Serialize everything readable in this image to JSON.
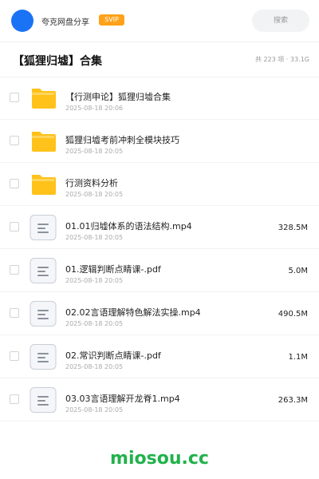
{
  "header": {
    "brand": "夸克网盘分享",
    "vip_badge": "SVIP",
    "search_placeholder": "搜索"
  },
  "folder": {
    "title": "【狐狸归墟】合集",
    "summary": "共 223 项 · 33.1G"
  },
  "items": [
    {
      "type": "folder",
      "name": "【行测申论】狐狸归墟合集",
      "date": "2025-08-18 20:06",
      "size": ""
    },
    {
      "type": "folder",
      "name": "狐狸归墟考前冲刺全模块技巧",
      "date": "2025-08-18 20:05",
      "size": ""
    },
    {
      "type": "folder",
      "name": "行测资料分析",
      "date": "2025-08-18 20:05",
      "size": ""
    },
    {
      "type": "file",
      "name": "01.01归墟体系的语法结构.mp4",
      "date": "2025-08-18 20:05",
      "size": "328.5M"
    },
    {
      "type": "file",
      "name": "01.逻辑判断点睛课-.pdf",
      "date": "2025-08-18 20:05",
      "size": "5.0M"
    },
    {
      "type": "file",
      "name": "02.02言语理解特色解法实操.mp4",
      "date": "2025-08-18 20:05",
      "size": "490.5M"
    },
    {
      "type": "file",
      "name": "02.常识判断点睛课-.pdf",
      "date": "2025-08-18 20:05",
      "size": "1.1M"
    },
    {
      "type": "file",
      "name": "03.03言语理解开龙脊1.mp4",
      "date": "2025-08-18 20:05",
      "size": "263.3M"
    }
  ],
  "watermark": "miosou.cc",
  "colors": {
    "accent": "#1a73f5",
    "vip": "#ffa21a",
    "folder": "#ffc21a",
    "watermark": "#22b24c"
  },
  "icons": {
    "folder": "folder-icon",
    "file": "document-icon"
  }
}
